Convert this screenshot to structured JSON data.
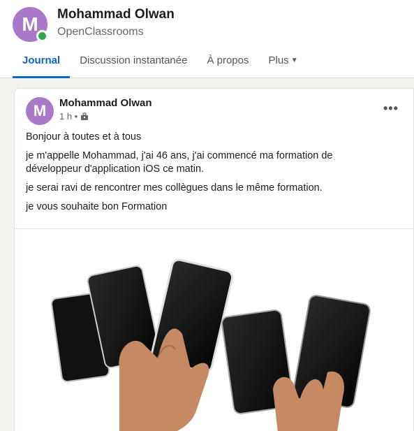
{
  "profile": {
    "avatar_letter": "M",
    "name": "Mohammad Olwan",
    "subtitle": "OpenClassrooms",
    "avatar_color": "#a978c8",
    "status_color": "#2fa84f"
  },
  "tabs": [
    {
      "label": "Journal",
      "active": true
    },
    {
      "label": "Discussion instantanée",
      "active": false
    },
    {
      "label": "À propos",
      "active": false
    },
    {
      "label": "Plus",
      "active": false
    }
  ],
  "post": {
    "avatar_letter": "M",
    "author": "Mohammad Olwan",
    "time": "1 h •",
    "menu_icon": "more-horizontal-icon",
    "paragraphs": [
      "Bonjour à toutes et à tous",
      "je m'appelle Mohammad, j'ai 46 ans, j'ai commencé ma formation de développeur d'application iOS ce matin.",
      "je serai ravi de rencontrer mes collègues dans le même formation.",
      "je vous souhaite bon Formation"
    ]
  },
  "colors": {
    "accent": "#0a66c2",
    "background": "#f3f2ef"
  }
}
